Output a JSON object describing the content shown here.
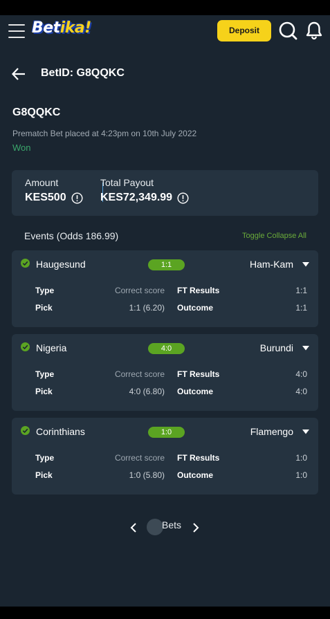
{
  "brand": {
    "logo_text_main": "Bet",
    "logo_text_accent": "ika!",
    "accent_color": "#f6d21a"
  },
  "topnav": {
    "deposit_label": "Deposit"
  },
  "page": {
    "title": "BetID: G8QQKC",
    "bet_code": "G8QQKC",
    "placed_info": "Prematch Bet placed at 4:23pm on 10th July 2022",
    "status": "Won"
  },
  "amounts": {
    "amount_label": "Amount",
    "amount_value": "KES500",
    "payout_label": "Total Payout",
    "payout_value": "KES72,349.99"
  },
  "events_header": {
    "label": "Events (Odds 186.99)",
    "toggle_label": "Toggle Collapse All"
  },
  "events": [
    {
      "home": "Haugesund",
      "score": "1:1",
      "away": "Ham-Kam",
      "type_label": "Type",
      "type_value": "Correct score",
      "pick_label": "Pick",
      "pick_value": "1:1 (6.20)",
      "ft_label": "FT Results",
      "ft_value": "1:1",
      "outcome_label": "Outcome",
      "outcome_value": "1:1"
    },
    {
      "home": "Nigeria",
      "score": "4:0",
      "away": "Burundi",
      "type_label": "Type",
      "type_value": "Correct score",
      "pick_label": "Pick",
      "pick_value": "4:0 (6.80)",
      "ft_label": "FT Results",
      "ft_value": "4:0",
      "outcome_label": "Outcome",
      "outcome_value": "4:0"
    },
    {
      "home": "Corinthians",
      "score": "1:0",
      "away": "Flamengo",
      "type_label": "Type",
      "type_value": "Correct score",
      "pick_label": "Pick",
      "pick_value": "1:0 (5.80)",
      "ft_label": "FT Results",
      "ft_value": "1:0",
      "outcome_label": "Outcome",
      "outcome_value": "1:0"
    }
  ],
  "pager": {
    "label": "Bets"
  },
  "icons": [
    "menu-icon",
    "search-icon",
    "bell-icon",
    "back-arrow-icon",
    "info-icon",
    "check-circle-icon",
    "caret-down-icon",
    "chevron-left-icon",
    "chevron-right-icon"
  ]
}
